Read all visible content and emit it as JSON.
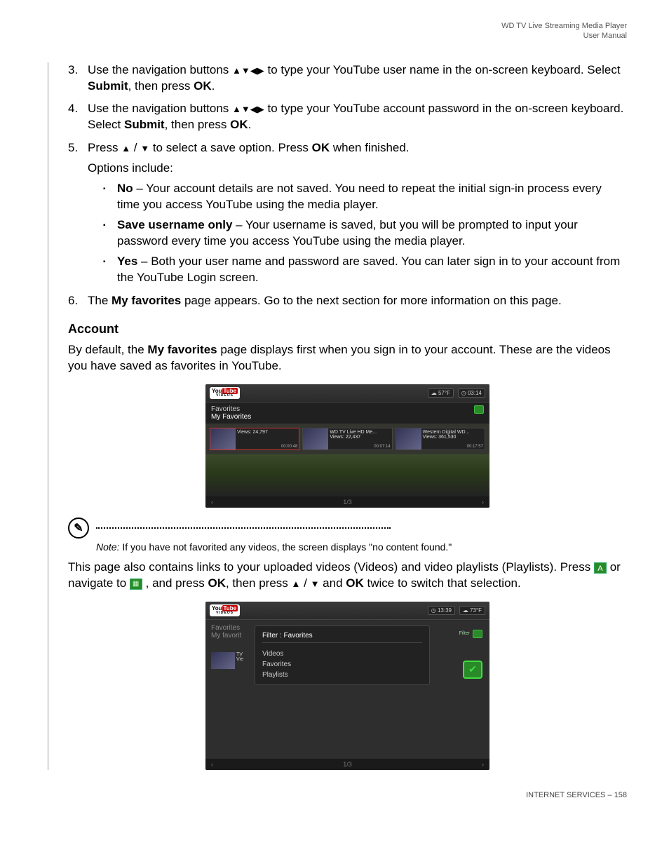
{
  "header": {
    "line1": "WD TV Live Streaming Media Player",
    "line2": "User Manual"
  },
  "steps": {
    "s3_a": "Use the navigation buttons ",
    "s3_b": " to type your YouTube user name in the on-screen keyboard. Select ",
    "s3_submit": "Submit",
    "s3_c": ", then press ",
    "s3_ok": "OK",
    "s3_d": ".",
    "s4_a": "Use the navigation buttons ",
    "s4_b": " to type your YouTube account password in the on-screen keyboard. Select ",
    "s5_a": "Press ",
    "s5_b": " to select a save option. Press ",
    "s5_c": " when finished.",
    "s5_opts": "Options include:",
    "no_b": "No",
    "no_t": " – Your account details are not saved. You need to repeat the initial sign-in process every time you access YouTube using the media player.",
    "su_b": "Save username only",
    "su_t": " – Your username is saved, but you will be prompted to input your password every time you access YouTube using the media player.",
    "yes_b": "Yes",
    "yes_t": " – Both your user name and password are saved. You can later sign in to your account from the YouTube Login screen.",
    "s6_a": "The ",
    "s6_b": "My favorites",
    "s6_c": " page appears. Go to the next section for more information on this page."
  },
  "account": {
    "heading": "Account",
    "p1_a": "By default, the ",
    "p1_b": "My favorites",
    "p1_c": " page displays first when you sign in to your account. These are the videos you have saved as favorites in YouTube.",
    "note_label": "Note:",
    "note_text": " If you have not favorited any videos, the screen displays \"no content found.\"",
    "p2_a": "This page also contains links to your uploaded videos (Videos) and video playlists (Playlists). Press ",
    "p2_b": " or navigate to ",
    "p2_c": ", and press ",
    "p2_ok": "OK",
    "p2_d": ", then press ",
    "p2_e": " and ",
    "p2_f": " twice to switch that selection."
  },
  "shot1": {
    "logo_a": "You",
    "logo_b": "Tube",
    "logo_sub": "VIDEOS",
    "temp": "57°F",
    "time": "03:14",
    "title1": "Favorites",
    "title2": "My Favorites",
    "thumbs": [
      {
        "title": "",
        "views": "Views: 24,797",
        "dur": "00:00:48"
      },
      {
        "title": "WD TV Live HD Me...",
        "views": "Views: 22,437",
        "dur": "00:07:14"
      },
      {
        "title": "Western Digital WD...",
        "views": "Views: 361,530",
        "dur": "00:17:57"
      }
    ],
    "page": "1/3"
  },
  "shot2": {
    "time": "13:39",
    "temp": "73°F",
    "title1": "Favorites",
    "title2": "My favorit",
    "menu_title": "Filter : Favorites",
    "menu_items": [
      "Videos",
      "Favorites",
      "Playlists"
    ],
    "filter_label": "Filter",
    "page": "1/3",
    "row_label": "TV",
    "row_views": "Vie"
  },
  "footer": {
    "section": "INTERNET SERVICES",
    "sep": " – ",
    "page": "158"
  },
  "glyphs": {
    "arrows4": "▲▼◀▶",
    "up": "▲",
    "down": "▼",
    "slash": " / ",
    "A": "A",
    "chev_l": "‹",
    "chev_r": "›",
    "check": "✔",
    "clock": "◷",
    "cloud": "☁"
  }
}
